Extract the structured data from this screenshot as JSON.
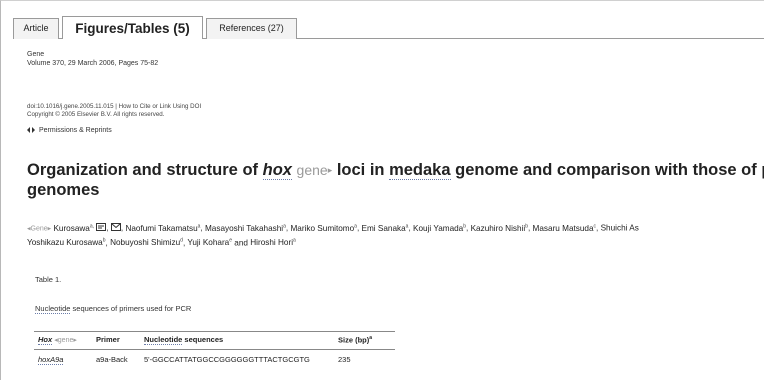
{
  "tabs": [
    {
      "label": "Article"
    },
    {
      "label": "Figures/Tables (5)"
    },
    {
      "label": "References (27)"
    }
  ],
  "publication": {
    "journal": "Gene",
    "volume_line": "Volume 370, 29 March 2006, Pages 75-82"
  },
  "meta": {
    "doi_line": "doi:10.1016/j.gene.2005.11.015 | How to Cite or Link Using DOI",
    "copyright": "Copyright © 2005 Elsevier B.V. All rights reserved.",
    "permissions": "Permissions & Reprints"
  },
  "article": {
    "title_start": "Organization and structure of ",
    "title_hox": "hox",
    "title_gene_tag": "gene",
    "title_mid": " loci in ",
    "title_medaka": "medaka",
    "title_end": " genome and comparison with those of p",
    "title_line2": "genomes"
  },
  "authors": {
    "gene_tag": "Gene",
    "line1": [
      {
        "name": "Kurosawa",
        "sup": "a,"
      },
      {
        "name": "Naofumi Takamatsu",
        "sup": "a"
      },
      {
        "name": "Masayoshi Takahashi",
        "sup": "a"
      },
      {
        "name": "Mariko Sumitomo",
        "sup": "a"
      },
      {
        "name": "Emi Sanaka",
        "sup": "a"
      },
      {
        "name": "Kouji Yamada",
        "sup": "b"
      },
      {
        "name": "Kazuhiro Nishii",
        "sup": "b"
      },
      {
        "name": "Masaru Matsuda",
        "sup": "c"
      },
      {
        "name": "Shuichi As",
        "sup": ""
      }
    ],
    "line2": [
      {
        "name": "Yoshikazu Kurosawa",
        "sup": "b"
      },
      {
        "name": "Nobuyoshi Shimizu",
        "sup": "d"
      },
      {
        "name": "Yuji Kohara",
        "sup": "e"
      },
      {
        "name": "Hiroshi Hori",
        "sup": "a"
      }
    ],
    "and_word": "and"
  },
  "table": {
    "label": "Table 1.",
    "caption_link": "Nucleotide",
    "caption_rest": " sequences of primers used for PCR",
    "headers": {
      "hox": "Hox",
      "gene_tag": "gene",
      "primer": "Primer",
      "seq_link": "Nucleotide",
      "seq_rest": " sequences",
      "size": "Size (bp)",
      "size_sup": "a"
    },
    "rows": [
      {
        "gene": "hoxA9a",
        "primer": "a9a-Back",
        "sequence": "5'-GGCCATTATGGCCGGGGGGTTTACTGCGTG",
        "size": "235"
      }
    ]
  }
}
